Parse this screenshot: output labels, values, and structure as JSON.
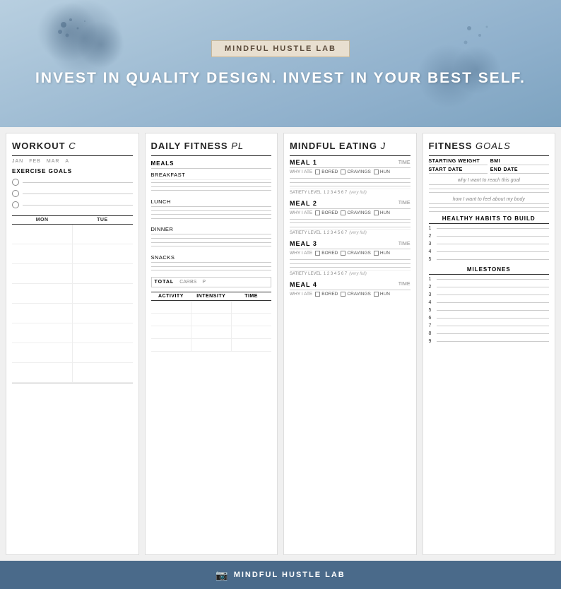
{
  "header": {
    "brand": "MINDFUL HUSTLE LAB",
    "tagline": "INVEST IN QUALITY DESIGN. INVEST IN YOUR BEST SELF."
  },
  "panel1": {
    "title": "WORKOUT ",
    "title_italic": "C",
    "months": [
      "JAN",
      "FEB",
      "MAR",
      "A"
    ],
    "exercise_goals": "EXERCISE GOALS",
    "days": [
      "MON",
      "TUE"
    ],
    "workout_rows": 8
  },
  "panel2": {
    "title": "DAILY FITNESS ",
    "title_italic": "PL",
    "meals": [
      "MEALS",
      "BREAKFAST",
      "LUNCH",
      "DINNER",
      "SNACKS"
    ],
    "totals_label": "TOTAL",
    "totals_carbs": "CARBS",
    "totals_p": "P",
    "activity_cols": [
      "ACTIVITY",
      "INTENSITY",
      "TIME"
    ],
    "activity_rows": 4
  },
  "panel3": {
    "title": "MINDFUL EATING ",
    "title_italic": "J",
    "meals": [
      {
        "number": "MEAL 1",
        "time_label": "TIME",
        "why_label": "WHY I ATE",
        "checkboxes": [
          "BORED",
          "CRAVINGS",
          "HUN"
        ],
        "satiety": "SATIETY LEVEL  1  2  3  4  5  6  7  (very full)"
      },
      {
        "number": "MEAL 2",
        "time_label": "TIME",
        "why_label": "WHY I ATE",
        "checkboxes": [
          "BORED",
          "CRAVINGS",
          "HUN"
        ],
        "satiety": "SATIETY LEVEL  1  2  3  4  5  6  7  (very full)"
      },
      {
        "number": "MEAL 3",
        "time_label": "TIME",
        "why_label": "WHY I ATE",
        "checkboxes": [
          "BORED",
          "CRAVINGS",
          "HUN"
        ],
        "satiety": "SATIETY LEVEL  1  2  3  4  5  6  7  (very full)"
      },
      {
        "number": "MEAL 4",
        "time_label": "TIME",
        "why_label": "WHY I ATE",
        "checkboxes": [
          "BORED",
          "CRAVINGS",
          "HUN"
        ],
        "satiety": ""
      }
    ],
    "bored_cravings_text": "Bored Cravings"
  },
  "panel4": {
    "title": "FITNESS ",
    "title_italic": "GOALS",
    "starting_weight": "STARTING WEIGHT",
    "bmi": "BMI",
    "start_date": "START DATE",
    "end_date": "END DATE",
    "goal_text1": "why I want to reach this goal",
    "goal_text2": "how I want to feel about my body",
    "healthy_habits_title": "HEALTHY HABITS TO BUILD",
    "habits_count": 5,
    "milestones_title": "MILESTONES",
    "milestones_count": 9
  },
  "footer": {
    "brand": "MINDFUL HUSTLE LAB",
    "icon": "📷"
  }
}
